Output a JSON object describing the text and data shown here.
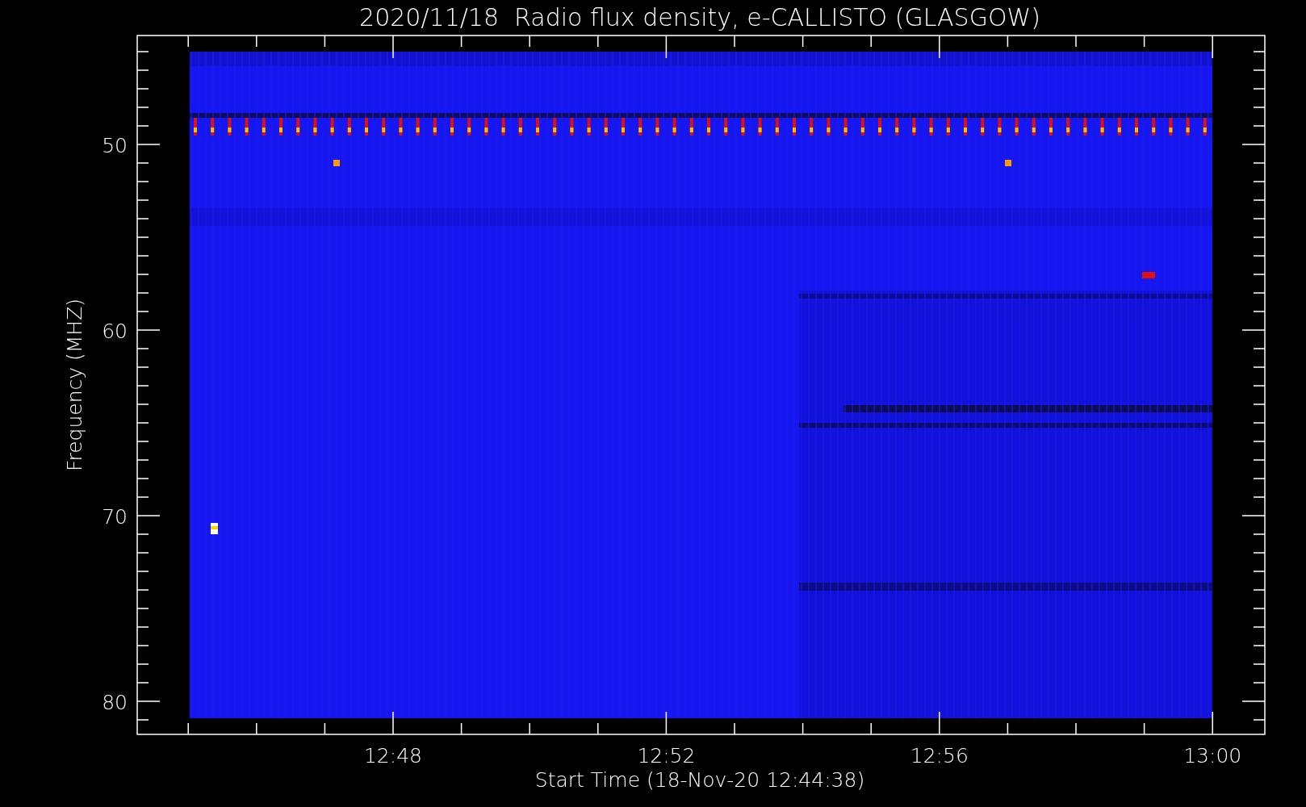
{
  "title": "2020/11/18  Radio flux density, e-CALLISTO (GLASGOW)",
  "x_axis": {
    "label": "Start Time (18-Nov-20 12:44:38)",
    "ticks": [
      "12:48",
      "12:52",
      "12:56",
      "13:00"
    ]
  },
  "y_axis": {
    "label": "Frequency (MHZ)",
    "ticks": [
      "50",
      "60",
      "70",
      "80"
    ]
  }
}
